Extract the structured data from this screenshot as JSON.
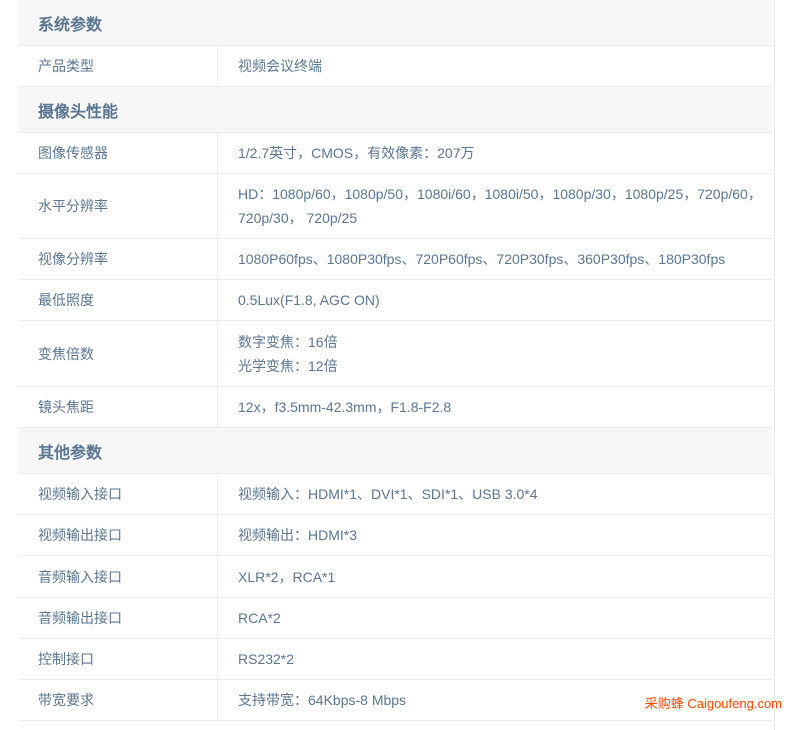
{
  "sections": {
    "system": {
      "title": "系统参数",
      "rows": [
        {
          "label": "产品类型",
          "value": "视频会议终端"
        }
      ]
    },
    "camera": {
      "title": "摄像头性能",
      "rows": [
        {
          "label": "图像传感器",
          "value": "1/2.7英寸，CMOS，有效像素：207万"
        },
        {
          "label": "水平分辨率",
          "value_line1": "HD：1080p/60，1080p/50，1080i/60，1080i/50，1080p/30，1080p/25，720p/60，",
          "value_line2": "720p/30， 720p/25"
        },
        {
          "label": "视像分辨率",
          "value": "1080P60fps、1080P30fps、720P60fps、720P30fps、360P30fps、180P30fps"
        },
        {
          "label": "最低照度",
          "value": "0.5Lux(F1.8, AGC ON)"
        },
        {
          "label": "变焦倍数",
          "value_line1": "数字变焦：16倍",
          "value_line2": "光学变焦：12倍"
        },
        {
          "label": "镜头焦距",
          "value": "12x，f3.5mm-42.3mm，F1.8-F2.8"
        }
      ]
    },
    "other": {
      "title": "其他参数",
      "rows": [
        {
          "label": "视频输入接口",
          "value": "视频输入：HDMI*1、DVI*1、SDI*1、USB 3.0*4"
        },
        {
          "label": "视频输出接口",
          "value": "视频输出：HDMI*3"
        },
        {
          "label": "音频输入接口",
          "value": "XLR*2，RCA*1"
        },
        {
          "label": "音频输出接口",
          "value": "RCA*2"
        },
        {
          "label": "控制接口",
          "value": "RS232*2"
        },
        {
          "label": "带宽要求",
          "value": "支持带宽：64Kbps-8 Mbps"
        }
      ]
    }
  },
  "watermark": "采购蜂 Caigoufeng.com"
}
